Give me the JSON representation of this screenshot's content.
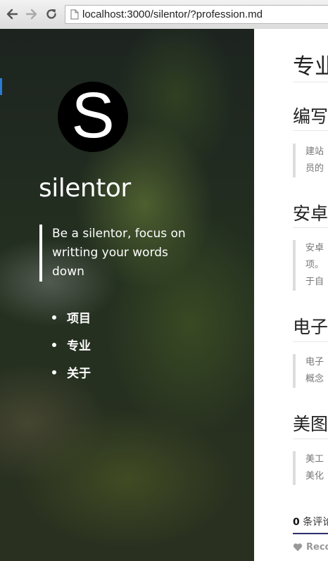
{
  "browser": {
    "url": "localhost:3000/silentor/?profession.md",
    "back_icon": "arrow-left-icon",
    "forward_icon": "arrow-right-icon",
    "reload_icon": "reload-icon",
    "page_icon": "page-icon"
  },
  "sidebar": {
    "logo_letter": "S",
    "site_name": "silentor",
    "tagline_lines": [
      "Be a silentor, focus on",
      "writting your words",
      "down"
    ],
    "nav": [
      {
        "label": "项目"
      },
      {
        "label": "专业"
      },
      {
        "label": "关于"
      }
    ]
  },
  "content": {
    "title": "专业",
    "sections": [
      {
        "title": "编写",
        "lines": [
          "建站",
          "员的"
        ]
      },
      {
        "title": "安卓",
        "lines": [
          "安卓",
          "项。",
          "于自"
        ]
      },
      {
        "title": "电子",
        "lines": [
          "电子",
          "概念"
        ]
      },
      {
        "title": "美图",
        "lines": [
          "美工",
          "美化"
        ]
      }
    ],
    "comments_count": "0",
    "comments_label": "条评论",
    "recommend_label": "Reco",
    "recommend_icon": "heart-icon"
  },
  "colors": {
    "accent": "#2a7bd3",
    "comment_rule": "#2e2e6e"
  }
}
